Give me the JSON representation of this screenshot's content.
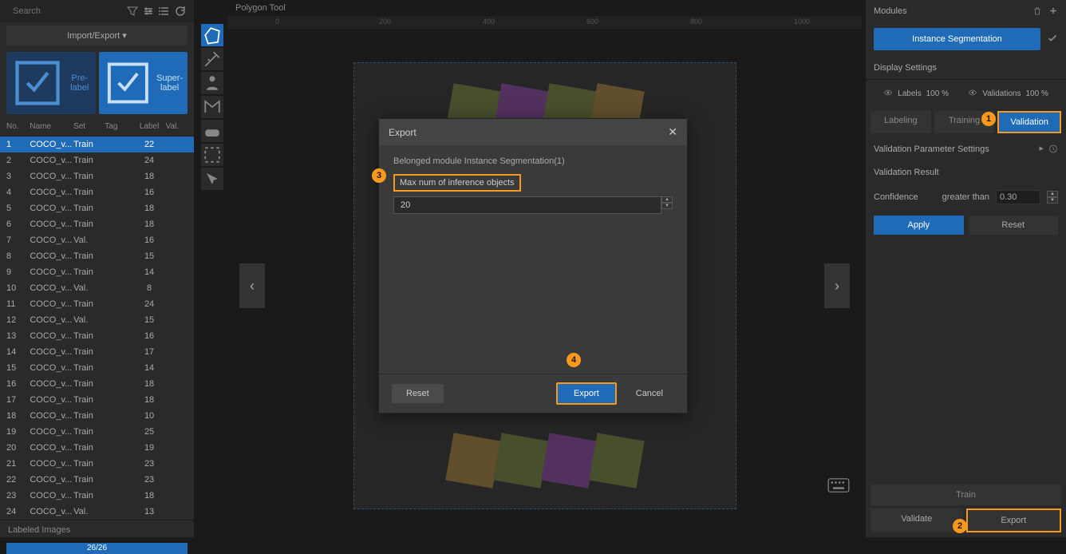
{
  "search": {
    "placeholder": "Search"
  },
  "import_export": "Import/Export ▾",
  "label_btns": {
    "pre": "Pre-label",
    "super": "Super-label"
  },
  "table": {
    "headers": {
      "no": "No.",
      "name": "Name",
      "set": "Set",
      "tag": "Tag",
      "label": "Label",
      "val": "Val."
    },
    "rows": [
      {
        "no": "1",
        "name": "COCO_v...",
        "set": "Train",
        "tag": "",
        "label": "22",
        "val": ""
      },
      {
        "no": "2",
        "name": "COCO_v...",
        "set": "Train",
        "tag": "",
        "label": "24",
        "val": ""
      },
      {
        "no": "3",
        "name": "COCO_v...",
        "set": "Train",
        "tag": "",
        "label": "18",
        "val": ""
      },
      {
        "no": "4",
        "name": "COCO_v...",
        "set": "Train",
        "tag": "",
        "label": "16",
        "val": ""
      },
      {
        "no": "5",
        "name": "COCO_v...",
        "set": "Train",
        "tag": "",
        "label": "18",
        "val": ""
      },
      {
        "no": "6",
        "name": "COCO_v...",
        "set": "Train",
        "tag": "",
        "label": "18",
        "val": ""
      },
      {
        "no": "7",
        "name": "COCO_v...",
        "set": "Val.",
        "tag": "",
        "label": "16",
        "val": ""
      },
      {
        "no": "8",
        "name": "COCO_v...",
        "set": "Train",
        "tag": "",
        "label": "15",
        "val": ""
      },
      {
        "no": "9",
        "name": "COCO_v...",
        "set": "Train",
        "tag": "",
        "label": "14",
        "val": ""
      },
      {
        "no": "10",
        "name": "COCO_v...",
        "set": "Val.",
        "tag": "",
        "label": "8",
        "val": ""
      },
      {
        "no": "11",
        "name": "COCO_v...",
        "set": "Train",
        "tag": "",
        "label": "24",
        "val": ""
      },
      {
        "no": "12",
        "name": "COCO_v...",
        "set": "Val.",
        "tag": "",
        "label": "15",
        "val": ""
      },
      {
        "no": "13",
        "name": "COCO_v...",
        "set": "Train",
        "tag": "",
        "label": "16",
        "val": ""
      },
      {
        "no": "14",
        "name": "COCO_v...",
        "set": "Train",
        "tag": "",
        "label": "17",
        "val": ""
      },
      {
        "no": "15",
        "name": "COCO_v...",
        "set": "Train",
        "tag": "",
        "label": "14",
        "val": ""
      },
      {
        "no": "16",
        "name": "COCO_v...",
        "set": "Train",
        "tag": "",
        "label": "18",
        "val": ""
      },
      {
        "no": "17",
        "name": "COCO_v...",
        "set": "Train",
        "tag": "",
        "label": "18",
        "val": ""
      },
      {
        "no": "18",
        "name": "COCO_v...",
        "set": "Train",
        "tag": "",
        "label": "10",
        "val": ""
      },
      {
        "no": "19",
        "name": "COCO_v...",
        "set": "Train",
        "tag": "",
        "label": "25",
        "val": ""
      },
      {
        "no": "20",
        "name": "COCO_v...",
        "set": "Train",
        "tag": "",
        "label": "19",
        "val": ""
      },
      {
        "no": "21",
        "name": "COCO_v...",
        "set": "Train",
        "tag": "",
        "label": "23",
        "val": ""
      },
      {
        "no": "22",
        "name": "COCO_v...",
        "set": "Train",
        "tag": "",
        "label": "23",
        "val": ""
      },
      {
        "no": "23",
        "name": "COCO_v...",
        "set": "Train",
        "tag": "",
        "label": "18",
        "val": ""
      },
      {
        "no": "24",
        "name": "COCO_v...",
        "set": "Val.",
        "tag": "",
        "label": "13",
        "val": ""
      }
    ]
  },
  "labeled_images": {
    "label": "Labeled Images",
    "progress": "26/26"
  },
  "canvas": {
    "title": "Polygon Tool",
    "ruler_marks": [
      "0",
      "200",
      "400",
      "600",
      "800",
      "1000"
    ]
  },
  "right": {
    "modules": "Modules",
    "instance_seg": "Instance Segmentation",
    "display_settings": "Display Settings",
    "labels": "Labels",
    "labels_pct": "100 %",
    "validations": "Validations",
    "validations_pct": "100 %",
    "tabs": {
      "labeling": "Labeling",
      "training": "Training",
      "validation": "Validation"
    },
    "param_settings": "Validation Parameter Settings",
    "validation_result": "Validation Result",
    "confidence": "Confidence",
    "greater_than": "greater than",
    "conf_val": "0.30",
    "apply": "Apply",
    "reset": "Reset",
    "train": "Train",
    "validate": "Validate",
    "export": "Export"
  },
  "modal": {
    "title": "Export",
    "belonged": "Belonged module Instance Segmentation(1)",
    "field": "Max num of inference objects",
    "value": "20",
    "reset": "Reset",
    "export": "Export",
    "cancel": "Cancel"
  },
  "callouts": {
    "c1": "1",
    "c2": "2",
    "c3": "3",
    "c4": "4"
  }
}
